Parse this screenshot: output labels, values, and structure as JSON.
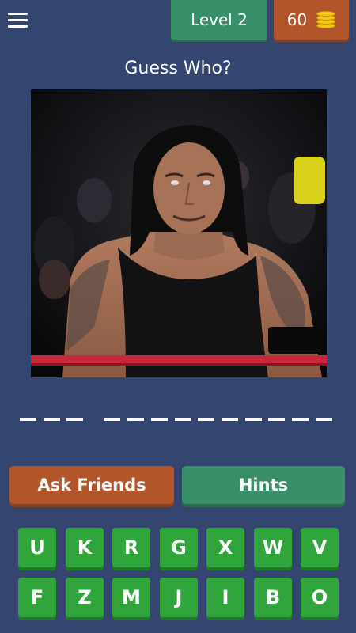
{
  "header": {
    "level_label": "Level 2",
    "coins": "60",
    "menu_icon": "hamburger-menu-icon",
    "coin_icon": "coin-stack-icon"
  },
  "title": "Guess Who?",
  "answer": {
    "word_lengths": [
      3,
      10
    ]
  },
  "buttons": {
    "ask_friends": "Ask Friends",
    "hints": "Hints"
  },
  "keyboard": {
    "row1": [
      "U",
      "K",
      "R",
      "G",
      "X",
      "W",
      "V"
    ],
    "row2": [
      "F",
      "Z",
      "M",
      "J",
      "I",
      "B",
      "O"
    ]
  },
  "colors": {
    "background": "#34466f",
    "level_badge": "#3a8f6b",
    "coins_badge": "#b2552b",
    "key": "#2fa53c"
  }
}
